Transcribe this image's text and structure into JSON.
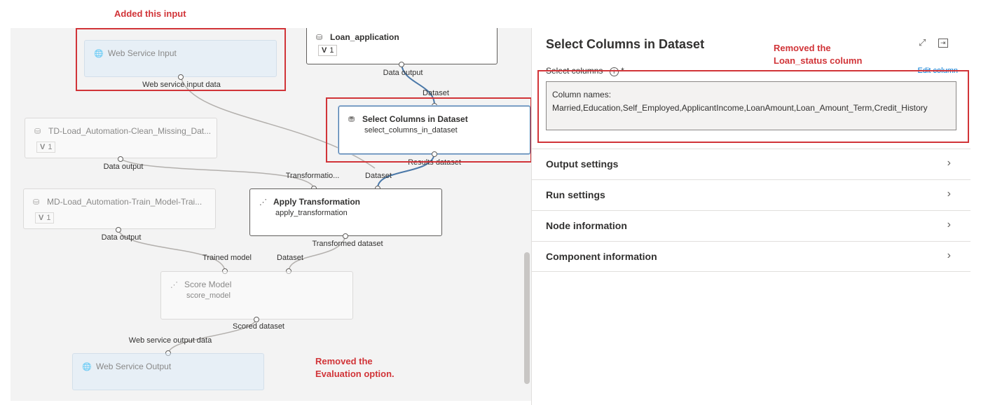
{
  "annotations": {
    "added_input": "Added this input",
    "removed_column": "Removed the\nLoan_status column",
    "removed_evaluation": "Removed the\nEvaluation option."
  },
  "nodes": {
    "web_service_input": {
      "title": "Web Service Input",
      "icon": "globe-icon"
    },
    "loan_application": {
      "title": "Loan_application",
      "version": "V",
      "version_num": "1",
      "icon": "dataset-icon"
    },
    "td_load": {
      "title": "TD-Load_Automation-Clean_Missing_Dat...",
      "version": "V",
      "version_num": "1",
      "icon": "dataset-icon"
    },
    "select_columns": {
      "title": "Select Columns in Dataset",
      "subtitle": "select_columns_in_dataset",
      "icon": "database-icon"
    },
    "md_load": {
      "title": "MD-Load_Automation-Train_Model-Trai...",
      "version": "V",
      "version_num": "1",
      "icon": "dataset-icon"
    },
    "apply_transformation": {
      "title": "Apply Transformation",
      "subtitle": "apply_transformation",
      "icon": "chart-icon"
    },
    "score_model": {
      "title": "Score Model",
      "subtitle": "score_model",
      "icon": "chart-icon"
    },
    "web_service_output": {
      "title": "Web Service Output",
      "icon": "globe-icon"
    }
  },
  "port_labels": {
    "web_service_input_data": "Web service input data",
    "loan_data_output": "Data output",
    "select_dataset": "Dataset",
    "select_results": "Results dataset",
    "td_data_output": "Data output",
    "apply_transformation_in": "Transformatio...",
    "apply_dataset": "Dataset",
    "md_data_output": "Data output",
    "transformed_dataset": "Transformed dataset",
    "trained_model": "Trained model",
    "score_dataset": "Dataset",
    "scored_dataset": "Scored dataset",
    "web_service_output_data": "Web service output data"
  },
  "panel": {
    "title": "Select Columns in Dataset",
    "expand_icon": "expand-icon",
    "collapse_icon": "collapse-panel-icon",
    "select_columns_label": "Select columns",
    "info_icon": "info-icon",
    "required_mark": "*",
    "edit_column": "Edit column",
    "column_names_label": "Column names:",
    "column_names_value": "Married,Education,Self_Employed,ApplicantIncome,LoanAmount,Loan_Amount_Term,Credit_History",
    "sections": [
      "Output settings",
      "Run settings",
      "Node information",
      "Component information"
    ]
  },
  "colors": {
    "annotation_red": "#d13438",
    "selected_edge": "#4a78a8",
    "webservice_fill": "#deecf9"
  }
}
